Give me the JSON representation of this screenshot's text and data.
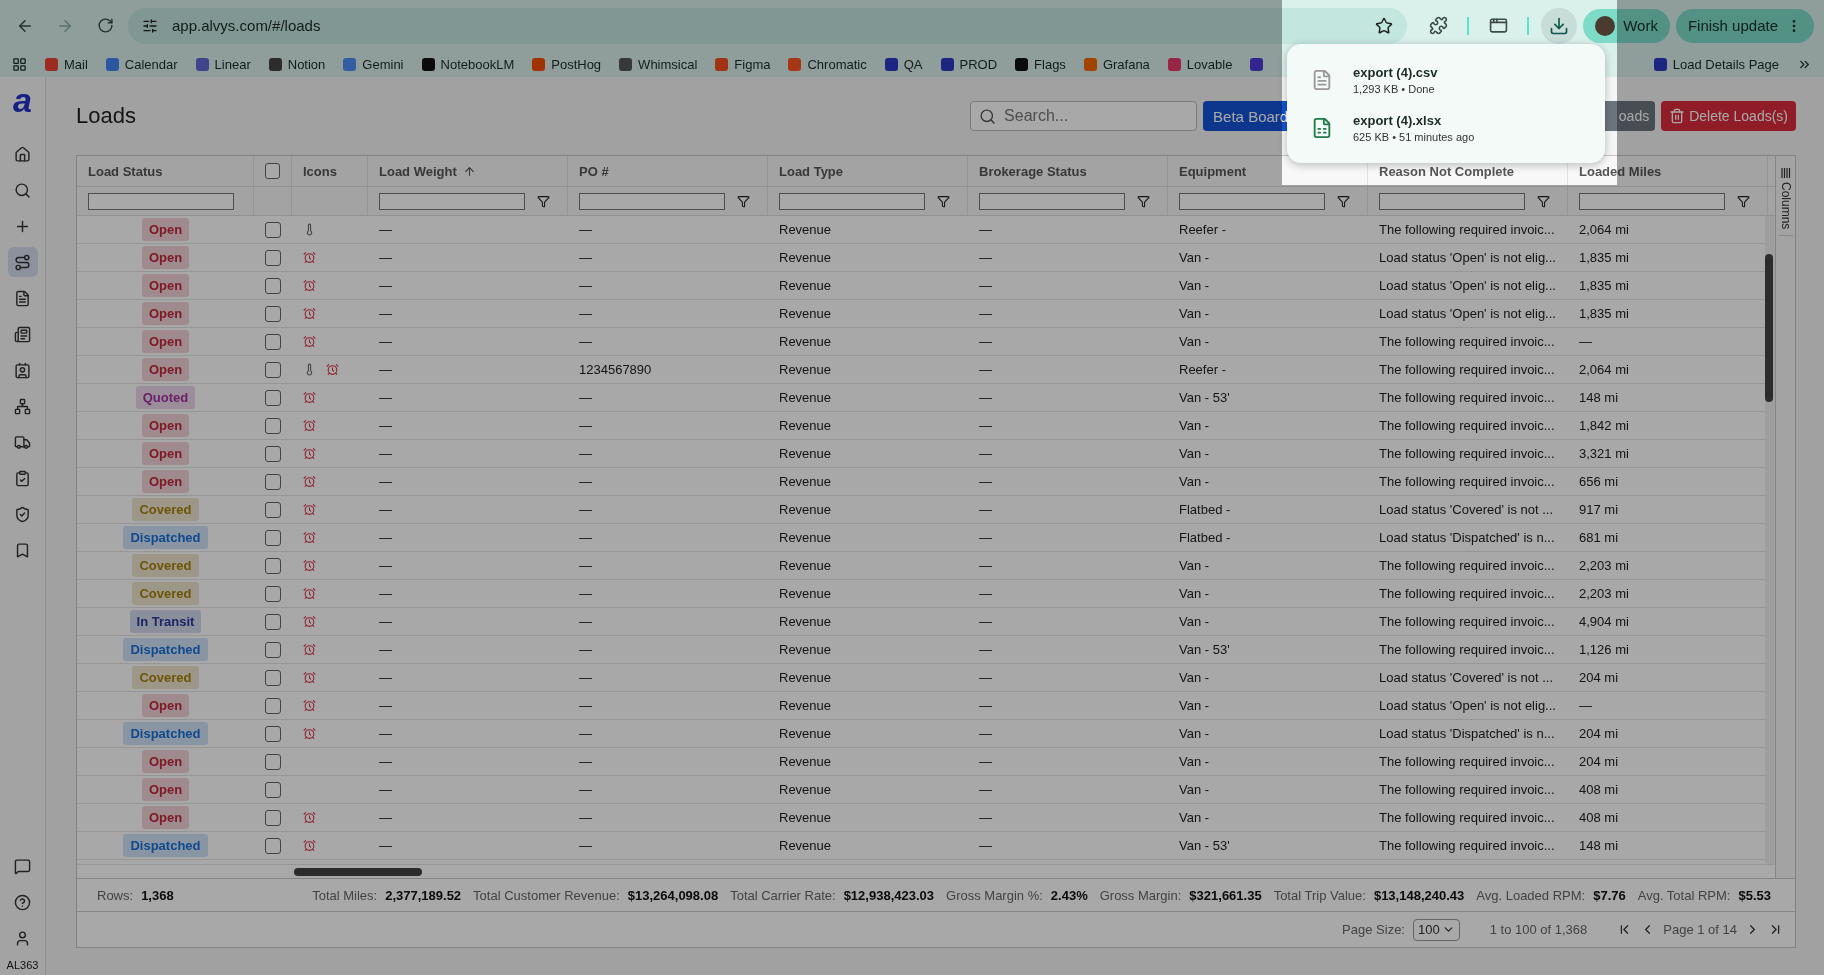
{
  "browser": {
    "url": "app.alvys.com/#/loads",
    "profile": "Work",
    "update_button": "Finish update"
  },
  "bookmarks": [
    {
      "kind": "link",
      "label": "Mail"
    },
    {
      "kind": "link",
      "label": "Calendar"
    },
    {
      "kind": "link",
      "label": "Linear"
    },
    {
      "kind": "link",
      "label": "Notion"
    },
    {
      "kind": "link",
      "label": "Gemini"
    },
    {
      "kind": "link",
      "label": "NotebookLM"
    },
    {
      "kind": "link",
      "label": "PostHog"
    },
    {
      "kind": "link",
      "label": "Whimsical"
    },
    {
      "kind": "link",
      "label": "Figma"
    },
    {
      "kind": "link",
      "label": "Chromatic"
    },
    {
      "kind": "link",
      "label": "QA"
    },
    {
      "kind": "link",
      "label": "PROD"
    },
    {
      "kind": "link",
      "label": "Flags"
    },
    {
      "kind": "link",
      "label": "Grafana"
    },
    {
      "kind": "link",
      "label": "Lovable"
    },
    {
      "kind": "icon"
    },
    {
      "kind": "link",
      "label": "Load Details Page"
    }
  ],
  "downloads": [
    {
      "kind": "csv",
      "name": "export (4).csv",
      "meta": "1,293 KB • Done"
    },
    {
      "kind": "xlsx",
      "name": "export (4).xlsx",
      "meta": "625 KB • 51 minutes ago"
    }
  ],
  "sidebar": {
    "logo": "a",
    "items": [
      {
        "selected": false
      },
      {
        "selected": false
      },
      {
        "selected": false
      },
      {
        "selected": true
      },
      {
        "selected": false
      },
      {
        "selected": false
      },
      {
        "selected": false
      },
      {
        "selected": false
      },
      {
        "selected": false
      },
      {
        "selected": false
      },
      {
        "selected": false
      },
      {
        "selected": false
      }
    ],
    "user_code": "AL363"
  },
  "page": {
    "title": "Loads",
    "search": {
      "placeholder": "Search..."
    },
    "buttons": [
      {
        "kind": "primary",
        "label": "Beta Board"
      },
      {
        "kind": "secondary",
        "label": "oads"
      },
      {
        "kind": "danger",
        "label": "Delete Loads(s)"
      }
    ]
  },
  "table": {
    "columns": [
      {
        "kind": "status",
        "label": "Load Status",
        "sorted_ascending": false,
        "filter": true
      },
      {
        "kind": "checkbox",
        "checked": false
      },
      {
        "kind": "icons",
        "label": "Icons",
        "sorted_ascending": false,
        "filter": false
      },
      {
        "kind": "text",
        "label": "Load Weight",
        "sorted_ascending": true,
        "filter": true
      },
      {
        "kind": "text",
        "label": "PO #",
        "sorted_ascending": false,
        "filter": true
      },
      {
        "kind": "text",
        "label": "Load Type",
        "sorted_ascending": false,
        "filter": true
      },
      {
        "kind": "text",
        "label": "Brokerage Status",
        "sorted_ascending": false,
        "filter": true
      },
      {
        "kind": "text",
        "label": "Equipment",
        "sorted_ascending": false,
        "filter": true
      },
      {
        "kind": "text",
        "label": "Reason Not Complete",
        "sorted_ascending": false,
        "filter": true
      },
      {
        "kind": "text",
        "label": "Loaded Miles",
        "sorted_ascending": false,
        "filter": true
      }
    ],
    "rows": [
      {
        "cells": [
          {
            "label": "Open",
            "kind": "open"
          },
          {
            "checked": false
          },
          [
            {
              "kind": "thermometer"
            }
          ],
          "—",
          "—",
          "Revenue",
          "—",
          "Reefer -",
          "The following required invoic...",
          "2,064 mi"
        ]
      },
      {
        "cells": [
          {
            "label": "Open",
            "kind": "open"
          },
          {
            "checked": false
          },
          [
            {
              "kind": "alarm"
            }
          ],
          "—",
          "—",
          "Revenue",
          "—",
          "Van -",
          "Load status 'Open' is not elig...",
          "1,835 mi"
        ]
      },
      {
        "cells": [
          {
            "label": "Open",
            "kind": "open"
          },
          {
            "checked": false
          },
          [
            {
              "kind": "alarm"
            }
          ],
          "—",
          "—",
          "Revenue",
          "—",
          "Van -",
          "Load status 'Open' is not elig...",
          "1,835 mi"
        ]
      },
      {
        "cells": [
          {
            "label": "Open",
            "kind": "open"
          },
          {
            "checked": false
          },
          [
            {
              "kind": "alarm"
            }
          ],
          "—",
          "—",
          "Revenue",
          "—",
          "Van -",
          "Load status 'Open' is not elig...",
          "1,835 mi"
        ]
      },
      {
        "cells": [
          {
            "label": "Open",
            "kind": "open"
          },
          {
            "checked": false
          },
          [
            {
              "kind": "alarm"
            }
          ],
          "—",
          "—",
          "Revenue",
          "—",
          "Van -",
          "The following required invoic...",
          "—"
        ]
      },
      {
        "cells": [
          {
            "label": "Open",
            "kind": "open"
          },
          {
            "checked": false
          },
          [
            {
              "kind": "thermometer"
            },
            {
              "kind": "alarm"
            }
          ],
          "—",
          "1234567890",
          "Revenue",
          "—",
          "Reefer -",
          "The following required invoic...",
          "2,064 mi"
        ]
      },
      {
        "cells": [
          {
            "label": "Quoted",
            "kind": "quoted"
          },
          {
            "checked": false
          },
          [
            {
              "kind": "alarm"
            }
          ],
          "—",
          "—",
          "Revenue",
          "—",
          "Van - 53'",
          "The following required invoic...",
          "148 mi"
        ]
      },
      {
        "cells": [
          {
            "label": "Open",
            "kind": "open"
          },
          {
            "checked": false
          },
          [
            {
              "kind": "alarm"
            }
          ],
          "—",
          "—",
          "Revenue",
          "—",
          "Van -",
          "The following required invoic...",
          "1,842 mi"
        ]
      },
      {
        "cells": [
          {
            "label": "Open",
            "kind": "open"
          },
          {
            "checked": false
          },
          [
            {
              "kind": "alarm"
            }
          ],
          "—",
          "—",
          "Revenue",
          "—",
          "Van -",
          "The following required invoic...",
          "3,321 mi"
        ]
      },
      {
        "cells": [
          {
            "label": "Open",
            "kind": "open"
          },
          {
            "checked": false
          },
          [
            {
              "kind": "alarm"
            }
          ],
          "—",
          "—",
          "Revenue",
          "—",
          "Van -",
          "The following required invoic...",
          "656 mi"
        ]
      },
      {
        "cells": [
          {
            "label": "Covered",
            "kind": "covered"
          },
          {
            "checked": false
          },
          [
            {
              "kind": "alarm"
            }
          ],
          "—",
          "—",
          "Revenue",
          "—",
          "Flatbed -",
          "Load status 'Covered' is not ...",
          "917 mi"
        ]
      },
      {
        "cells": [
          {
            "label": "Dispatched",
            "kind": "dispatched"
          },
          {
            "checked": false
          },
          [
            {
              "kind": "alarm"
            }
          ],
          "—",
          "—",
          "Revenue",
          "—",
          "Flatbed -",
          "Load status 'Dispatched' is n...",
          "681 mi"
        ]
      },
      {
        "cells": [
          {
            "label": "Covered",
            "kind": "covered"
          },
          {
            "checked": false
          },
          [
            {
              "kind": "alarm"
            }
          ],
          "—",
          "—",
          "Revenue",
          "—",
          "Van -",
          "The following required invoic...",
          "2,203 mi"
        ]
      },
      {
        "cells": [
          {
            "label": "Covered",
            "kind": "covered"
          },
          {
            "checked": false
          },
          [
            {
              "kind": "alarm"
            }
          ],
          "—",
          "—",
          "Revenue",
          "—",
          "Van -",
          "The following required invoic...",
          "2,203 mi"
        ]
      },
      {
        "cells": [
          {
            "label": "In Transit",
            "kind": "in_transit"
          },
          {
            "checked": false
          },
          [
            {
              "kind": "alarm"
            }
          ],
          "—",
          "—",
          "Revenue",
          "—",
          "Van -",
          "The following required invoic...",
          "4,904 mi"
        ]
      },
      {
        "cells": [
          {
            "label": "Dispatched",
            "kind": "dispatched"
          },
          {
            "checked": false
          },
          [
            {
              "kind": "alarm"
            }
          ],
          "—",
          "—",
          "Revenue",
          "—",
          "Van - 53'",
          "The following required invoic...",
          "1,126 mi"
        ]
      },
      {
        "cells": [
          {
            "label": "Covered",
            "kind": "covered"
          },
          {
            "checked": false
          },
          [
            {
              "kind": "alarm"
            }
          ],
          "—",
          "—",
          "Revenue",
          "—",
          "Van -",
          "Load status 'Covered' is not ...",
          "204 mi"
        ]
      },
      {
        "cells": [
          {
            "label": "Open",
            "kind": "open"
          },
          {
            "checked": false
          },
          [
            {
              "kind": "alarm"
            }
          ],
          "—",
          "—",
          "Revenue",
          "—",
          "Van -",
          "Load status 'Open' is not elig...",
          "—"
        ]
      },
      {
        "cells": [
          {
            "label": "Dispatched",
            "kind": "dispatched"
          },
          {
            "checked": false
          },
          [
            {
              "kind": "alarm"
            }
          ],
          "—",
          "—",
          "Revenue",
          "—",
          "Van -",
          "Load status 'Dispatched' is n...",
          "204 mi"
        ]
      },
      {
        "cells": [
          {
            "label": "Open",
            "kind": "open"
          },
          {
            "checked": false
          },
          [],
          "—",
          "—",
          "Revenue",
          "—",
          "Van -",
          "The following required invoic...",
          "204 mi"
        ]
      },
      {
        "cells": [
          {
            "label": "Open",
            "kind": "open"
          },
          {
            "checked": false
          },
          [],
          "—",
          "—",
          "Revenue",
          "—",
          "Van -",
          "The following required invoic...",
          "408 mi"
        ]
      },
      {
        "cells": [
          {
            "label": "Open",
            "kind": "open"
          },
          {
            "checked": false
          },
          [
            {
              "kind": "alarm"
            }
          ],
          "—",
          "—",
          "Revenue",
          "—",
          "Van -",
          "The following required invoic...",
          "408 mi"
        ]
      },
      {
        "cells": [
          {
            "label": "Dispatched",
            "kind": "dispatched"
          },
          {
            "checked": false
          },
          [
            {
              "kind": "alarm"
            }
          ],
          "—",
          "—",
          "Revenue",
          "—",
          "Van - 53'",
          "The following required invoic...",
          "148 mi"
        ]
      }
    ],
    "side_panel": "Columns",
    "summary": {
      "rows_label": "Rows:",
      "rows_value": "1,368",
      "totals": [
        {
          "label": "Total Miles:",
          "value": "2,377,189.52"
        },
        {
          "label": "Total Customer Revenue:",
          "value": "$13,264,098.08"
        },
        {
          "label": "Total Carrier Rate:",
          "value": "$12,938,423.03"
        },
        {
          "label": "Gross Margin %:",
          "value": "2.43%"
        },
        {
          "label": "Gross Margin:",
          "value": "$321,661.35"
        },
        {
          "label": "Total Trip Value:",
          "value": "$13,148,240.43"
        },
        {
          "label": "Avg. Loaded RPM:",
          "value": "$7.76"
        },
        {
          "label": "Avg. Total RPM:",
          "value": "$5.53"
        }
      ]
    },
    "pagination": {
      "page_size_label": "Page Size:",
      "page_size": "100",
      "range": "1 to 100 of 1,368",
      "page": "Page 1 of 14"
    }
  }
}
